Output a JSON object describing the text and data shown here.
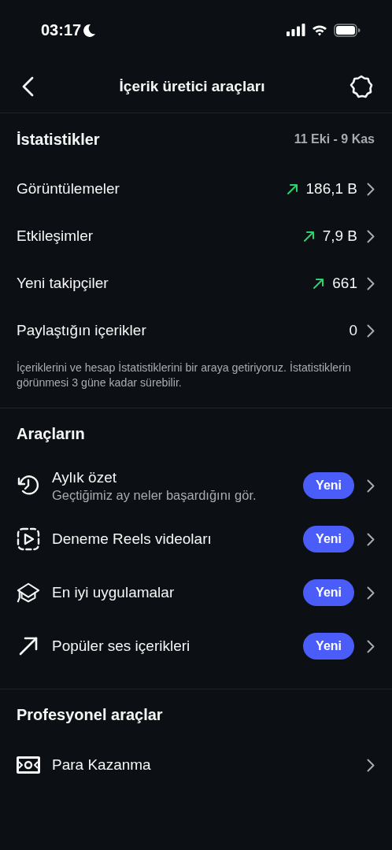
{
  "status_bar": {
    "time": "03:17"
  },
  "header": {
    "title": "İçerik üretici araçları"
  },
  "statistics": {
    "title": "İstatistikler",
    "date_range": "11 Eki - 9 Kas",
    "rows": [
      {
        "label": "Görüntülemeler",
        "value": "186,1 B",
        "trend_up": true
      },
      {
        "label": "Etkileşimler",
        "value": "7,9 B",
        "trend_up": true
      },
      {
        "label": "Yeni takipçiler",
        "value": "661",
        "trend_up": true
      },
      {
        "label": "Paylaştığın içerikler",
        "value": "0",
        "trend_up": false
      }
    ],
    "note": "İçeriklerini ve hesap İstatistiklerini bir araya getiriyoruz. İstatistiklerin görünmesi 3 güne kadar sürebilir."
  },
  "tools": {
    "title": "Araçların",
    "items": [
      {
        "kind": "history",
        "label": "Aylık özet",
        "subtitle": "Geçtiğimiz ay neler başardığını gör.",
        "badge": "Yeni"
      },
      {
        "kind": "reels",
        "label": "Deneme Reels videoları",
        "badge": "Yeni"
      },
      {
        "kind": "cap",
        "label": "En iyi uygulamalar",
        "badge": "Yeni"
      },
      {
        "kind": "arrow",
        "label": "Popüler ses içerikleri",
        "badge": "Yeni"
      }
    ]
  },
  "professional": {
    "title": "Profesyonel araçlar",
    "items": [
      {
        "kind": "money",
        "label": "Para Kazanma"
      }
    ]
  }
}
